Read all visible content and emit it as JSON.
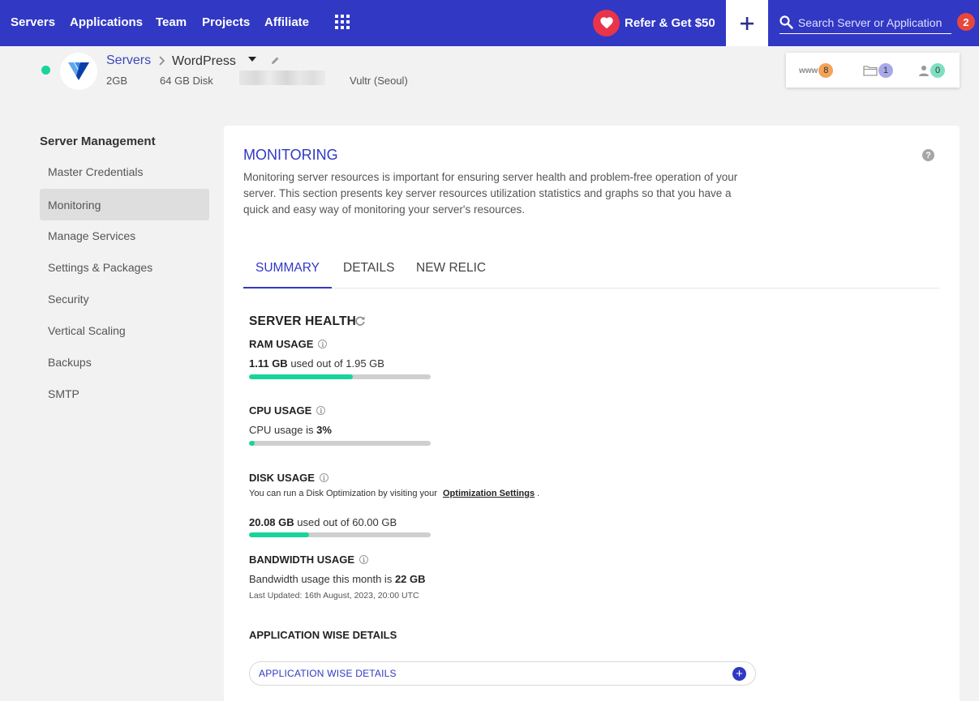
{
  "nav": {
    "links": [
      "Servers",
      "Applications",
      "Team",
      "Projects",
      "Affiliate"
    ],
    "refer_label": "Refer & Get $50",
    "search_placeholder": "Search Server or Application",
    "notification_count": "2"
  },
  "server": {
    "breadcrumb_root": "Servers",
    "app_name": "WordPress",
    "ram": "2GB",
    "disk": "64 GB Disk",
    "location": "Vultr (Seoul)",
    "status_color": "#19d49a",
    "counts": {
      "www_label": "www",
      "www": "8",
      "folders": "1",
      "users": "0"
    }
  },
  "sidebar": {
    "title": "Server Management",
    "items": [
      "Master Credentials",
      "Monitoring",
      "Manage Services",
      "Settings & Packages",
      "Security",
      "Vertical Scaling",
      "Backups",
      "SMTP"
    ],
    "active": "Monitoring"
  },
  "main": {
    "title": "MONITORING",
    "help": "?",
    "description": "Monitoring server resources is important for ensuring server health and problem-free operation of your server. This section presents key server resources utilization statistics and graphs so that you have a quick and easy way of monitoring your server's resources.",
    "tabs": [
      "SUMMARY",
      "DETAILS",
      "NEW RELIC"
    ],
    "active_tab": "SUMMARY",
    "health": {
      "title": "SERVER HEALTH",
      "ram": {
        "title": "RAM USAGE",
        "used": "1.11 GB",
        "text": "used out of 1.95 GB",
        "percent": 57
      },
      "cpu": {
        "title": "CPU USAGE",
        "text": "CPU usage is",
        "value": "3%",
        "percent": 3
      },
      "disk": {
        "title": "DISK USAGE",
        "note": "You can run a Disk Optimization by visiting your",
        "link": "Optimization Settings",
        "note_end": ".",
        "used": "20.08 GB",
        "text": "used out of 60.00 GB",
        "percent": 33
      },
      "bandwidth": {
        "title": "BANDWIDTH USAGE",
        "text": "Bandwidth usage this month is",
        "value": "22 GB",
        "updated": "Last Updated: 16th August, 2023, 20:00 UTC"
      }
    },
    "app_wise": {
      "title": "APPLICATION WISE DETAILS",
      "accordion_label": "APPLICATION WISE DETAILS"
    }
  },
  "colors": {
    "brand": "#3138c4",
    "accent": "#19d49a",
    "alert": "#e8473c",
    "heart": "#e9344a"
  }
}
